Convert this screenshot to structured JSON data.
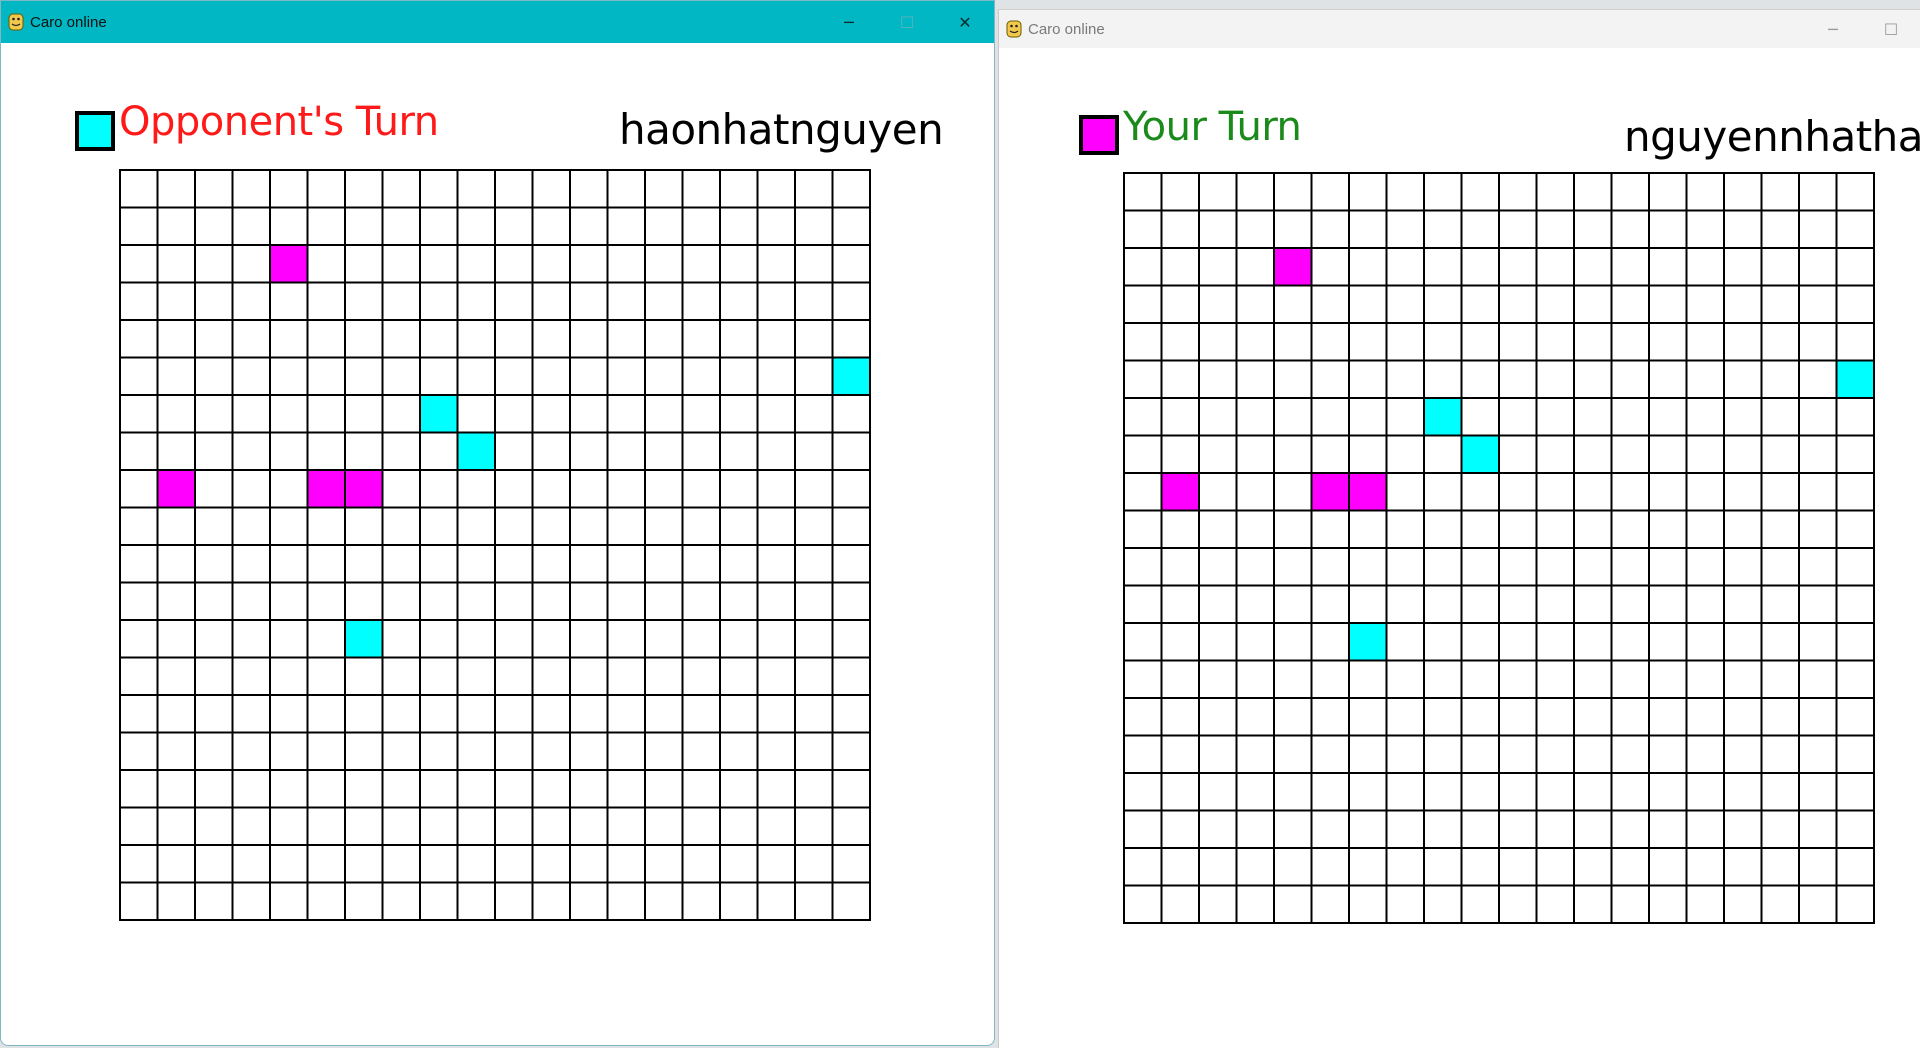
{
  "colors": {
    "player_magenta": "#ff00ff",
    "player_cyan": "#00ffff",
    "opponent_turn_text": "#ff1a1a",
    "your_turn_text": "#1a8a1a",
    "grid_line": "#000000",
    "active_titlebar": "#00b7c3"
  },
  "windows": [
    {
      "title": "Caro online",
      "active": true,
      "controls": {
        "minimize": "─",
        "maximize": "☐",
        "close": "✕"
      },
      "turn_label": "Opponent's Turn",
      "turn_swatch_color": "#00ffff",
      "player_name": "haonhatnguyen"
    },
    {
      "title": "Caro online",
      "active": false,
      "controls": {
        "minimize": "─",
        "maximize": "☐"
      },
      "turn_label": "Your Turn",
      "turn_swatch_color": "#ff00ff",
      "player_name": "nguyennhathao"
    }
  ],
  "board": {
    "rows": 20,
    "cols": 20,
    "moves": [
      {
        "row": 2,
        "col": 4,
        "player": "magenta"
      },
      {
        "row": 5,
        "col": 19,
        "player": "cyan"
      },
      {
        "row": 6,
        "col": 8,
        "player": "cyan"
      },
      {
        "row": 7,
        "col": 9,
        "player": "cyan"
      },
      {
        "row": 8,
        "col": 1,
        "player": "magenta"
      },
      {
        "row": 8,
        "col": 5,
        "player": "magenta"
      },
      {
        "row": 8,
        "col": 6,
        "player": "magenta"
      },
      {
        "row": 12,
        "col": 6,
        "player": "cyan"
      }
    ]
  }
}
